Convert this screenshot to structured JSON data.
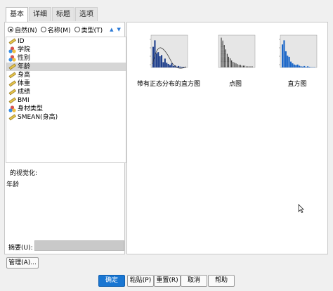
{
  "tabs": [
    {
      "label": "基本",
      "active": true
    },
    {
      "label": "详细",
      "active": false
    },
    {
      "label": "标题",
      "active": false
    },
    {
      "label": "选项",
      "active": false
    }
  ],
  "sort": {
    "options": [
      {
        "label": "自然(N)",
        "selected": true
      },
      {
        "label": "名称(M)",
        "selected": false
      },
      {
        "label": "类型(T)",
        "selected": false
      }
    ],
    "up_icon": "▲",
    "down_icon": "▼"
  },
  "variables": [
    {
      "label": "ID",
      "icon": "scale-ruler-icon",
      "selected": false
    },
    {
      "label": "学院",
      "icon": "nominal-icon",
      "selected": false
    },
    {
      "label": "性别",
      "icon": "nominal-icon",
      "selected": false
    },
    {
      "label": "年龄",
      "icon": "scale-ruler-icon",
      "selected": true
    },
    {
      "label": "身高",
      "icon": "scale-ruler-icon",
      "selected": false
    },
    {
      "label": "体重",
      "icon": "scale-ruler-icon",
      "selected": false
    },
    {
      "label": "成绩",
      "icon": "scale-ruler-icon",
      "selected": false
    },
    {
      "label": "BMI",
      "icon": "scale-ruler-icon",
      "selected": false
    },
    {
      "label": "身材类型",
      "icon": "nominal-icon",
      "selected": false
    },
    {
      "label": "SMEAN(身高)",
      "icon": "scale-ruler-icon",
      "selected": false
    }
  ],
  "visualization": {
    "label": "的视觉化:",
    "value": "年龄"
  },
  "summary": {
    "label": "摘要(U):",
    "value": ""
  },
  "gallery": [
    {
      "caption": "带有正态分布的直方图",
      "color": "#1f3f8c",
      "heights": [
        70,
        92,
        48,
        52,
        38,
        42,
        18,
        30,
        16,
        12,
        8,
        14,
        5,
        7,
        3,
        5,
        3,
        2,
        2,
        1
      ],
      "curve": true
    },
    {
      "caption": "点图",
      "color": "#222222",
      "heights": [],
      "curve": false
    },
    {
      "caption": "直方图",
      "color": "#1a66c8",
      "heights": [
        78,
        92,
        55,
        40,
        36,
        20,
        14,
        10,
        8,
        10,
        6,
        4,
        3,
        5,
        2,
        4,
        2,
        1,
        1,
        1
      ],
      "curve": false
    }
  ],
  "buttons": {
    "manage": "管理(A)...",
    "ok": "确定",
    "paste": "粘贴(P)",
    "reset": "重置(R)",
    "cancel": "取消",
    "help": "帮助"
  }
}
